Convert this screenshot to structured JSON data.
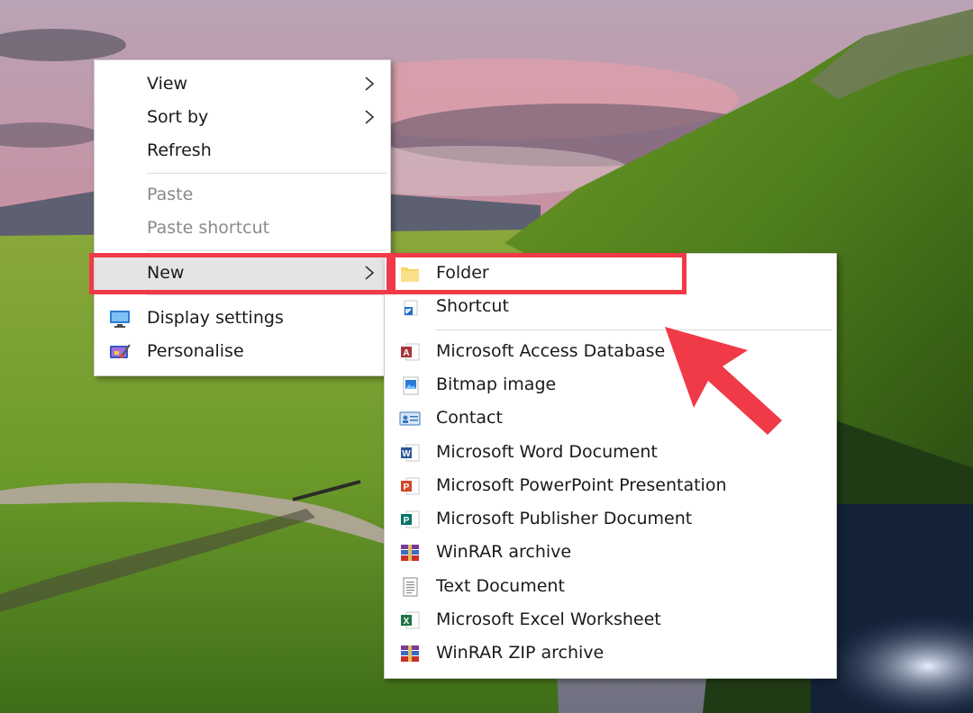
{
  "colors": {
    "annotation_red": "#f03a47",
    "menu_background": "#ffffff",
    "menu_text": "#1a1a1a",
    "menu_disabled_text": "#8a8a8a",
    "menu_hover": "#e4e4e4"
  },
  "context_menu": {
    "items": [
      {
        "label": "View",
        "submenu": true
      },
      {
        "label": "Sort by",
        "submenu": true
      },
      {
        "label": "Refresh"
      },
      {
        "label": "Paste",
        "disabled": true
      },
      {
        "label": "Paste shortcut",
        "disabled": true
      },
      {
        "label": "New",
        "submenu": true,
        "highlighted": true
      },
      {
        "label": "Display settings",
        "icon": "display-settings-icon"
      },
      {
        "label": "Personalise",
        "icon": "personalise-icon"
      }
    ]
  },
  "new_submenu": {
    "items": [
      {
        "label": "Folder",
        "icon": "folder-icon"
      },
      {
        "label": "Shortcut",
        "icon": "shortcut-icon"
      },
      {
        "label": "Microsoft Access Database",
        "icon": "access-icon"
      },
      {
        "label": "Bitmap image",
        "icon": "bitmap-icon"
      },
      {
        "label": "Contact",
        "icon": "contact-icon"
      },
      {
        "label": "Microsoft Word Document",
        "icon": "word-icon"
      },
      {
        "label": "Microsoft PowerPoint Presentation",
        "icon": "powerpoint-icon"
      },
      {
        "label": "Microsoft Publisher Document",
        "icon": "publisher-icon"
      },
      {
        "label": "WinRAR archive",
        "icon": "winrar-icon"
      },
      {
        "label": "Text Document",
        "icon": "text-document-icon"
      },
      {
        "label": "Microsoft Excel Worksheet",
        "icon": "excel-icon"
      },
      {
        "label": "WinRAR ZIP archive",
        "icon": "winrar-zip-icon"
      }
    ]
  }
}
